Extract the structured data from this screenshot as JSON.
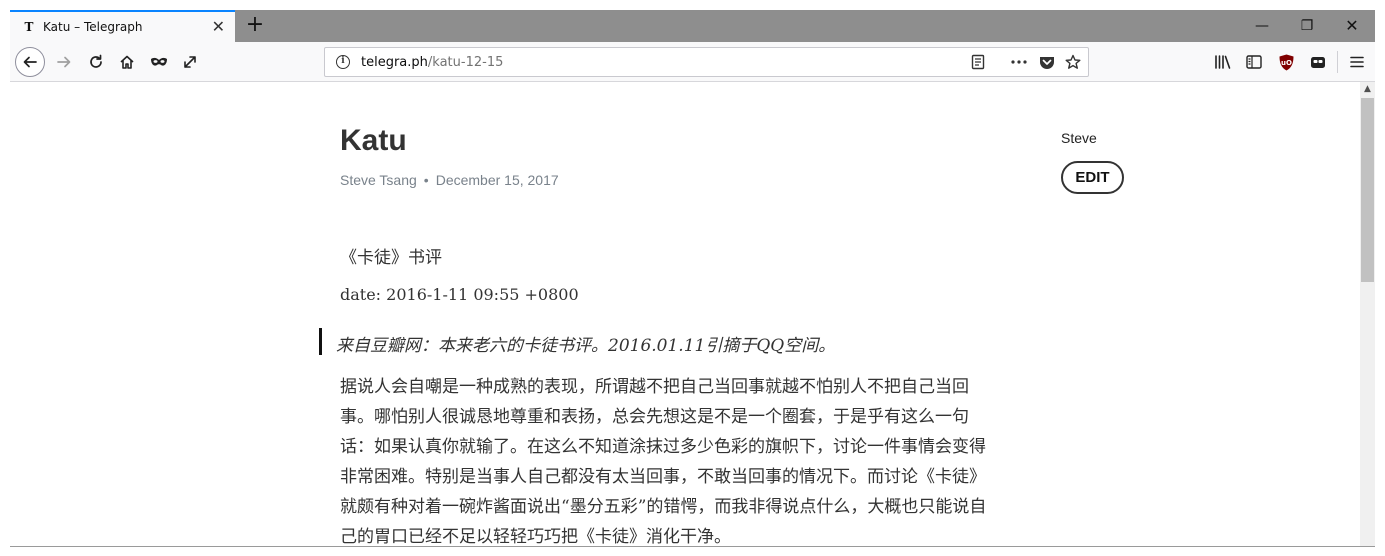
{
  "tab": {
    "favicon": "T",
    "title": "Katu – Telegraph",
    "close": "✕"
  },
  "window_controls": {
    "minimize": "—",
    "maximize": "❐",
    "close": "✕"
  },
  "newtab": "+",
  "url": {
    "host": "telegra.ph",
    "path": "/katu-12-15"
  },
  "toolbar_icons": [
    "back-icon",
    "forward-icon",
    "reload-icon",
    "home-icon",
    "mask-icon",
    "expand-icon",
    "reader-view-icon",
    "more-icon",
    "pocket-icon",
    "bookmark-star-icon",
    "library-icon",
    "sidebar-icon",
    "ublock-icon",
    "tab-icon",
    "menu-icon"
  ],
  "colors": {
    "accent": "#0a84ff",
    "tabbar": "#8e8e8e",
    "text": "#333333",
    "meta": "#79828b"
  },
  "article": {
    "title": "Katu",
    "author": "Steve Tsang",
    "separator": "•",
    "date": "December 15, 2017",
    "side_author": "Steve",
    "edit_label": "EDIT",
    "p1": "《卡徒》书评",
    "p2": "date: 2016-1-11 09:55 +0800",
    "quote": "来自豆瓣网：本来老六的卡徒书评。2016.01.11引摘于QQ空间。",
    "body_lines": [
      "据说人会自嘲是一种成熟的表现，所谓越不把自己当回事就越不怕别人不把自己当回",
      "事。哪怕别人很诚恳地尊重和表扬，总会先想这是不是一个圈套，于是乎有这么一句",
      "话：如果认真你就输了。在这么不知道涂抹过多少色彩的旗帜下，讨论一件事情会变得",
      "非常困难。特别是当事人自己都没有太当回事，不敢当回事的情况下。而讨论《卡徒》",
      "就颇有种对着一碗炸酱面说出“墨分五彩”的错愕，而我非得说点什么，大概也只能说自",
      "己的胃口已经不足以轻轻巧巧把《卡徒》消化干净。"
    ]
  }
}
